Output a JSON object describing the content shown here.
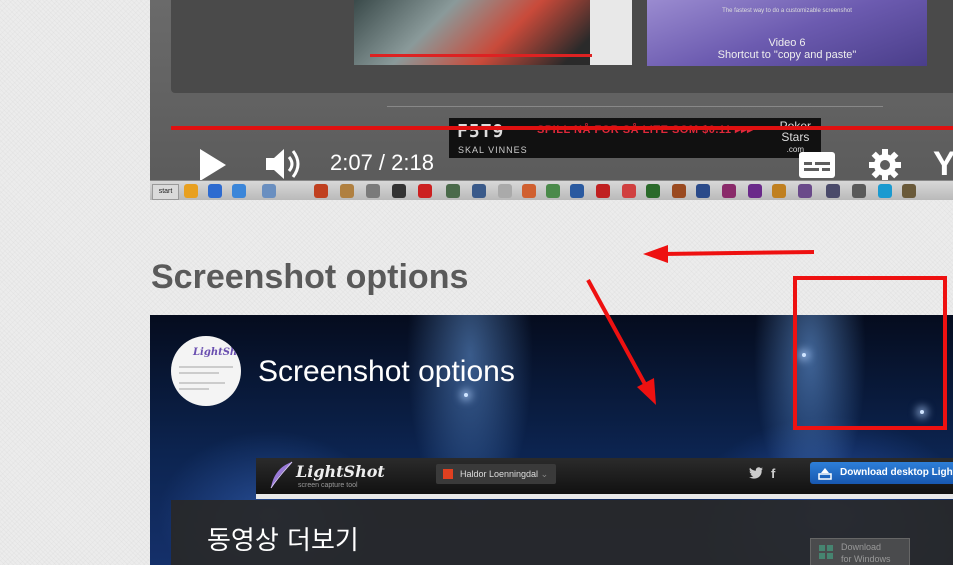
{
  "video1": {
    "thumb_topline": "The fastest way to do a customizable screenshot",
    "thumb_video_title": "Video 6",
    "thumb_video_subtitle": "Shortcut to \"copy and paste\"",
    "ad": {
      "digits": "F5T9",
      "tagline": "SKAL VINNES",
      "promo": "SPILL NÅ FOR SÅ LITE SOM $0.11 ▸▸▸",
      "brand_line1": "Poker",
      "brand_line2": "Stars",
      "brand_line3": ".com"
    },
    "progress": 0.98,
    "time": "2:07 / 2:18",
    "logo_text": "Yo",
    "start_label": "start",
    "colors": {
      "progress": "#e01010",
      "controls": "#ffffff"
    }
  },
  "section": {
    "heading": "Screenshot options"
  },
  "video2": {
    "channel_avatar_brand": "LightShot",
    "title": "Screenshot options",
    "lightshot_bar": {
      "logo": "LightShot",
      "tagline": "screen capture tool",
      "user": "Haldor Loenningdal",
      "twitter_icon": "twitter-icon",
      "facebook_icon": "facebook-icon",
      "download_label": "Download desktop Lightshot"
    },
    "more_videos_label": "동영상 더보기",
    "windows_button": {
      "line1": "Download",
      "line2": "for Windows"
    }
  },
  "annotations": {
    "color": "#ee1111"
  }
}
